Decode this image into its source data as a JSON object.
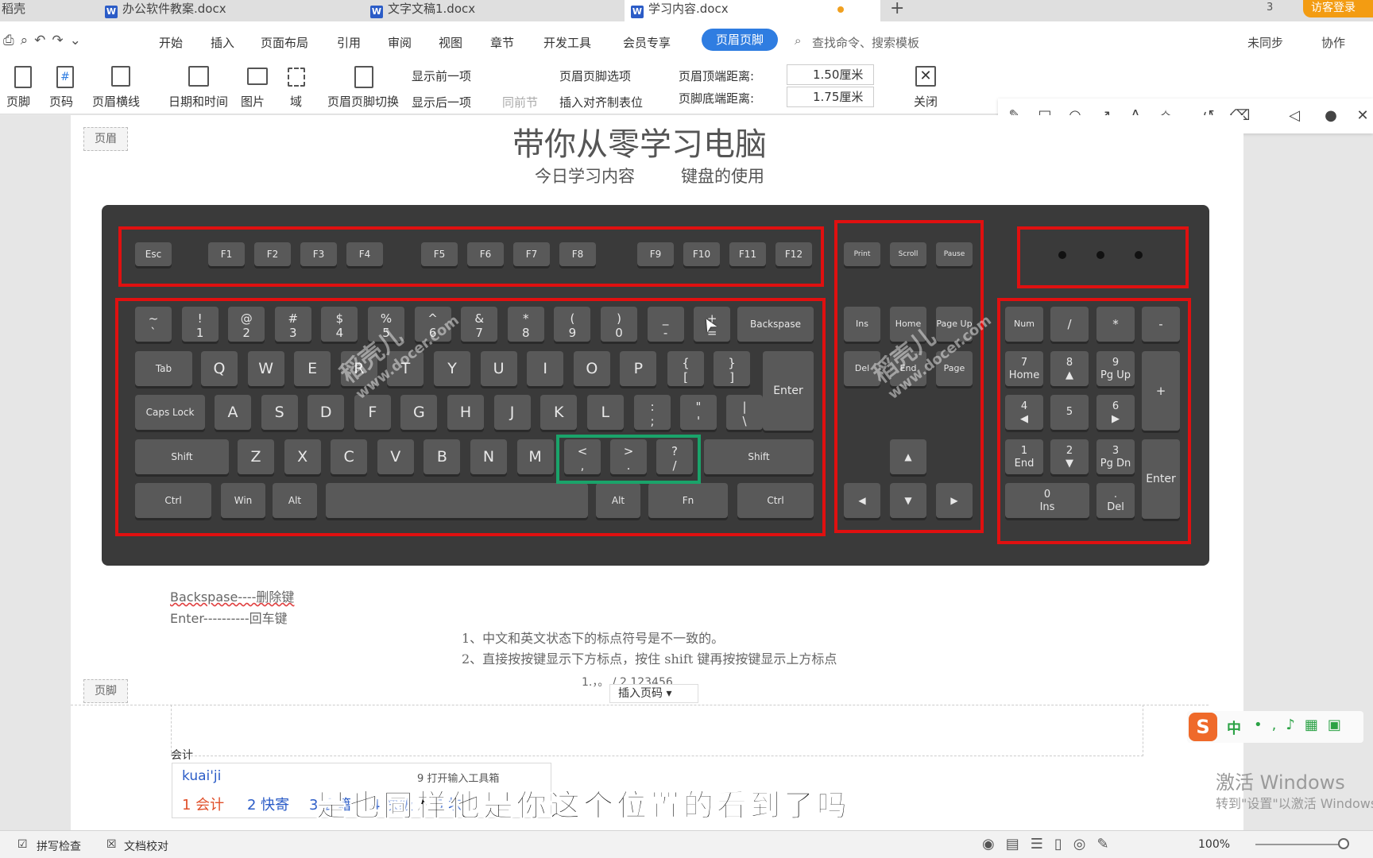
{
  "tabs": [
    {
      "label": "稻壳"
    },
    {
      "label": "办公软件教案.docx"
    },
    {
      "label": "文字文稿1.docx"
    },
    {
      "label": "学习内容.docx"
    }
  ],
  "tab_add": "+",
  "top_right": {
    "count": "3",
    "login": "访客登录"
  },
  "menu": {
    "items": [
      "开始",
      "插入",
      "页面布局",
      "引用",
      "审阅",
      "视图",
      "章节",
      "开发工具",
      "会员专享"
    ],
    "active": "页眉页脚",
    "search": "查找命令、搜索模板",
    "sync": "未同步",
    "collab": "协作"
  },
  "ribbon": {
    "footer": "页脚",
    "pagenum": "页码",
    "hline": "页眉横线",
    "datetime": "日期和时间",
    "picture": "图片",
    "field": "域",
    "switch": "页眉页脚切换",
    "prev": "显示前一项",
    "next": "显示后一项",
    "same": "同前节",
    "options": "页眉页脚选项",
    "align_tab": "插入对齐制表位",
    "top_dist_label": "页眉顶端距离:",
    "top_dist": "1.50厘米",
    "bottom_dist_label": "页脚底端距离:",
    "bottom_dist": "1.75厘米",
    "close": "关闭"
  },
  "doc": {
    "header_tag": "页眉",
    "footer_tag": "页脚",
    "title": "带你从零学习电脑",
    "subtitle": "今日学习内容",
    "subtitle2": "键盘的使用",
    "note1": "Backspase----删除键",
    "note2": "Enter----------回车键",
    "point1": "1、中文和英文状态下的标点符号是不一致的。",
    "point2": "2、直接按按键显示下方标点，按住 shift 键再按按键显示上方标点",
    "line3": "1.，。 /   2 123456",
    "insert_page": "插入页码",
    "footer_text": "会计"
  },
  "watermarks": [
    "稻壳儿",
    "www.docer.com"
  ],
  "keys": {
    "fn": [
      "Esc",
      "F1",
      "F2",
      "F3",
      "F4",
      "F5",
      "F6",
      "F7",
      "F8",
      "F9",
      "F10",
      "F11",
      "F12"
    ],
    "sys": [
      "Print Screen",
      "Scroll Lock",
      "Pause Break"
    ],
    "num_row": [
      [
        "~",
        "`"
      ],
      [
        "!",
        "1"
      ],
      [
        "@",
        "2"
      ],
      [
        "#",
        "3"
      ],
      [
        "$",
        "4"
      ],
      [
        "%",
        "5"
      ],
      [
        "^",
        "6"
      ],
      [
        "&",
        "7"
      ],
      [
        "*",
        "8"
      ],
      [
        "(",
        "9"
      ],
      [
        ")",
        "0"
      ],
      [
        "_",
        "-"
      ],
      [
        "+",
        "="
      ]
    ],
    "q_row": [
      "Q",
      "W",
      "E",
      "R",
      "T",
      "Y",
      "U",
      "I",
      "O",
      "P"
    ],
    "a_row": [
      "A",
      "S",
      "D",
      "F",
      "G",
      "H",
      "J",
      "K",
      "L"
    ],
    "z_row": [
      "Z",
      "X",
      "C",
      "V",
      "B",
      "N",
      "M"
    ],
    "labels": {
      "backspace": "Backspase",
      "tab": "Tab",
      "enter": "Enter",
      "caps": "Caps Lock",
      "shift": "Shift",
      "ctrl": "Ctrl",
      "win": "Win",
      "alt": "Alt",
      "fn": "Fn"
    },
    "punct": [
      [
        "{",
        "["
      ],
      [
        "}",
        "]"
      ],
      [
        ":",
        ";"
      ],
      [
        "\"",
        "'"
      ],
      [
        "|",
        "\\"
      ],
      [
        "<",
        ","
      ],
      [
        ">",
        "."
      ],
      [
        "?",
        "/"
      ]
    ],
    "nav": [
      "Ins",
      "Home",
      "Page Up",
      "Del",
      "End",
      "Page Down"
    ],
    "arrows": [
      "▲",
      "◀",
      "▼",
      "▶"
    ],
    "numpad": {
      "numlock": "Num Lock",
      "div": "/",
      "mul": "*",
      "sub": "-",
      "add": "+",
      "enter": "Enter",
      "k7": [
        "7",
        "Home"
      ],
      "k8": [
        "8",
        "▲"
      ],
      "k9": [
        "9",
        "Pg Up"
      ],
      "k4": [
        "4",
        "◀"
      ],
      "k5": [
        "5",
        ""
      ],
      "k6": [
        "6",
        "▶"
      ],
      "k1": [
        "1",
        "End"
      ],
      "k2": [
        "2",
        "▼"
      ],
      "k3": [
        "3",
        "Pg Dn"
      ],
      "k0": [
        "0",
        "Ins"
      ],
      "kdot": [
        ".",
        "Del"
      ]
    }
  },
  "ime": {
    "input": "kuai'ji",
    "toolbox": "9 打开输入工具箱",
    "candidates": [
      "1 会计",
      "2 快寄",
      "3 会籍",
      "4 快级",
      "5 块"
    ],
    "lang": "中"
  },
  "subtitle_caption": "是也同样他是你这个位置的看到了吗",
  "windows": {
    "line1": "激活 Windows",
    "line2": "转到\"设置\"以激活 Windows。"
  },
  "status": {
    "spell": "拼写检查",
    "proof": "文档校对",
    "zoom": "100%"
  }
}
